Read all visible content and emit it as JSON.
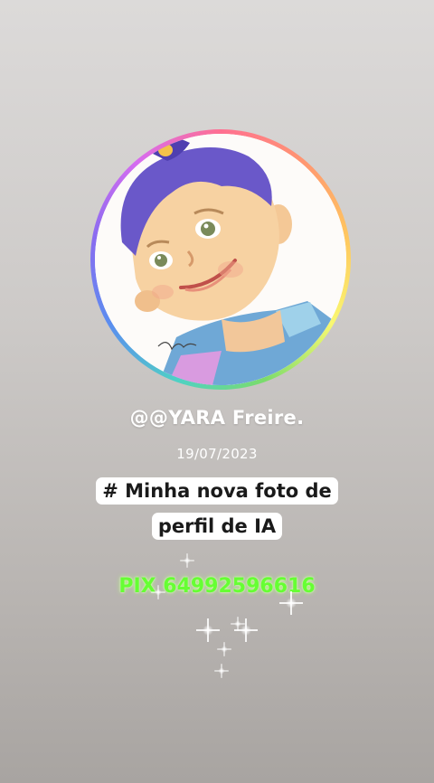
{
  "profile": {
    "username": "@@YARA Freire.",
    "date": "19/07/2023"
  },
  "caption": {
    "line1": "# Minha nova foto de",
    "line2": "perfil de IA"
  },
  "pix": {
    "text": "PIX 64992596616"
  },
  "colors": {
    "background_top": "#dcdad9",
    "background_bottom": "#a8a4a1",
    "pix_green": "#66ff33",
    "caption_box": "#ffffff"
  }
}
